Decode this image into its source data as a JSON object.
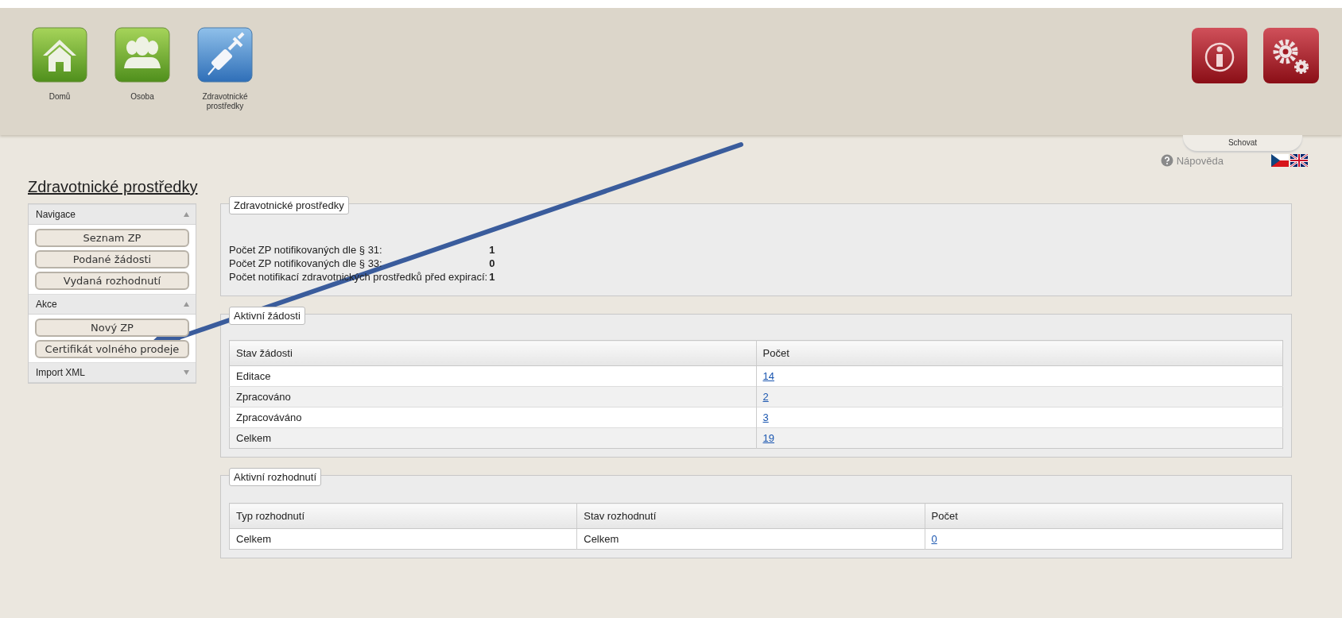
{
  "header": {
    "nav_tiles": [
      {
        "label": "Domů",
        "kind": "home"
      },
      {
        "label": "Osoba",
        "kind": "people"
      },
      {
        "label": "Zdravotnické prostředky",
        "kind": "syringe"
      }
    ],
    "tool_tiles": [
      {
        "kind": "info"
      },
      {
        "kind": "gears"
      }
    ],
    "hide_tab": "Schovat"
  },
  "help_link": "Nápověda",
  "languages": [
    {
      "kind": "cz"
    },
    {
      "kind": "gb"
    }
  ],
  "page_title": "Zdravotnické prostředky",
  "sidebar": {
    "sections": [
      {
        "title": "Navigace",
        "expanded": true,
        "items": [
          "Seznam ZP",
          "Podané žádosti",
          "Vydaná rozhodnutí"
        ]
      },
      {
        "title": "Akce",
        "expanded": true,
        "items": [
          "Nový ZP",
          "Certifikát volného prodeje"
        ]
      },
      {
        "title": "Import XML",
        "expanded": false
      }
    ]
  },
  "summary": {
    "legend": "Zdravotnické prostředky",
    "rows": [
      {
        "label": "Počet ZP notifikovaných dle § 31:",
        "value": "1"
      },
      {
        "label": "Počet ZP notifikovaných dle § 33:",
        "value": "0"
      },
      {
        "label": "Počet notifikací zdravotnických prostředků před expirací:",
        "value": "1"
      }
    ]
  },
  "requests": {
    "legend": "Aktivní žádosti",
    "columns": [
      "Stav žádosti",
      "Počet"
    ],
    "rows": [
      [
        "Editace",
        "14"
      ],
      [
        "Zpracováno",
        "2"
      ],
      [
        "Zpracováváno",
        "3"
      ],
      [
        "Celkem",
        "19"
      ]
    ]
  },
  "decisions": {
    "legend": "Aktivní rozhodnutí",
    "columns": [
      "Typ rozhodnutí",
      "Stav rozhodnutí",
      "Počet"
    ],
    "rows": [
      [
        "Celkem",
        "Celkem",
        "0"
      ]
    ]
  }
}
